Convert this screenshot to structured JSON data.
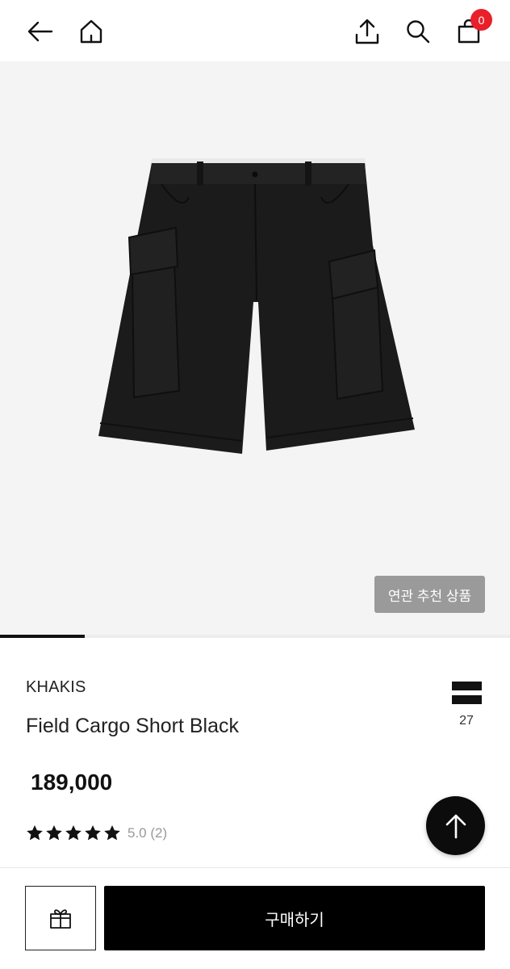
{
  "header": {
    "icons": [
      "back-arrow-icon",
      "home-icon",
      "share-icon",
      "search-icon",
      "shopping-bag-icon"
    ],
    "cart_count": "0"
  },
  "gallery": {
    "related_label": "연관 추천 상품",
    "progress": 0.166
  },
  "product": {
    "brand": "KHAKIS",
    "name": "Field Cargo Short Black",
    "price": "189,000",
    "rating_stars": 5,
    "rating_text": "5.0 (2)",
    "compare_count": "27"
  },
  "footer": {
    "buy_label": "구매하기",
    "gift_icon": "gift-icon"
  },
  "colors": {
    "badge": "#e8202a",
    "buy_button": "#000000",
    "related_button": "#9a9a9a"
  }
}
